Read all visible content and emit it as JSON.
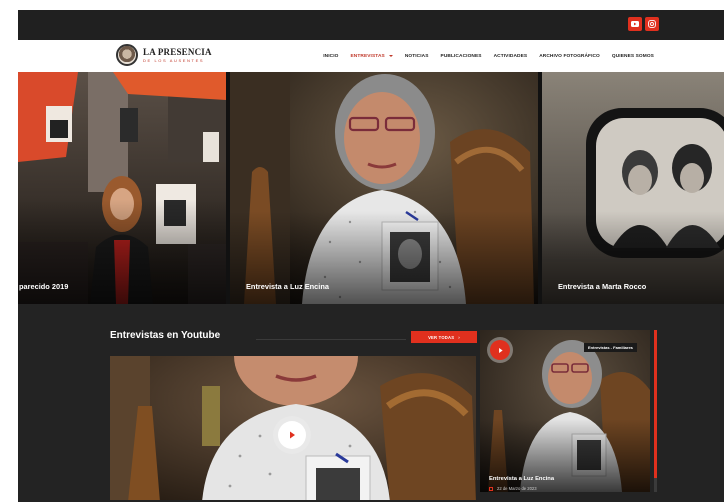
{
  "brand": {
    "line1": "LA PRESENCIA",
    "line2": "DE LOS AUSENTES",
    "accent": "#e0301e"
  },
  "social": {
    "youtube_icon": "youtube-icon",
    "instagram_icon": "instagram-icon"
  },
  "nav": {
    "items": [
      {
        "label": "INICIO"
      },
      {
        "label": "ENTREVISTAS"
      },
      {
        "label": "NOTICIAS"
      },
      {
        "label": "PUBLICACIONES"
      },
      {
        "label": "ACTIVIDADES"
      },
      {
        "label": "ARCHIVO FOTOGRÁFICO"
      },
      {
        "label": "QUIENES SOMOS"
      }
    ]
  },
  "hero": {
    "slides": [
      {
        "caption": "parecido 2019"
      },
      {
        "caption": "Entrevista a Luz Encina"
      },
      {
        "caption": "Entrevista a Marta Rocco"
      }
    ]
  },
  "section": {
    "title": "Entrevistas en Youtube",
    "button_label": "VER TODAS",
    "button_arrow": "›"
  },
  "side_video": {
    "tag": "Entrevistas - Familiares",
    "title": "Entrevista a Luz Encina",
    "date": "22 de Marzo de 2023"
  }
}
